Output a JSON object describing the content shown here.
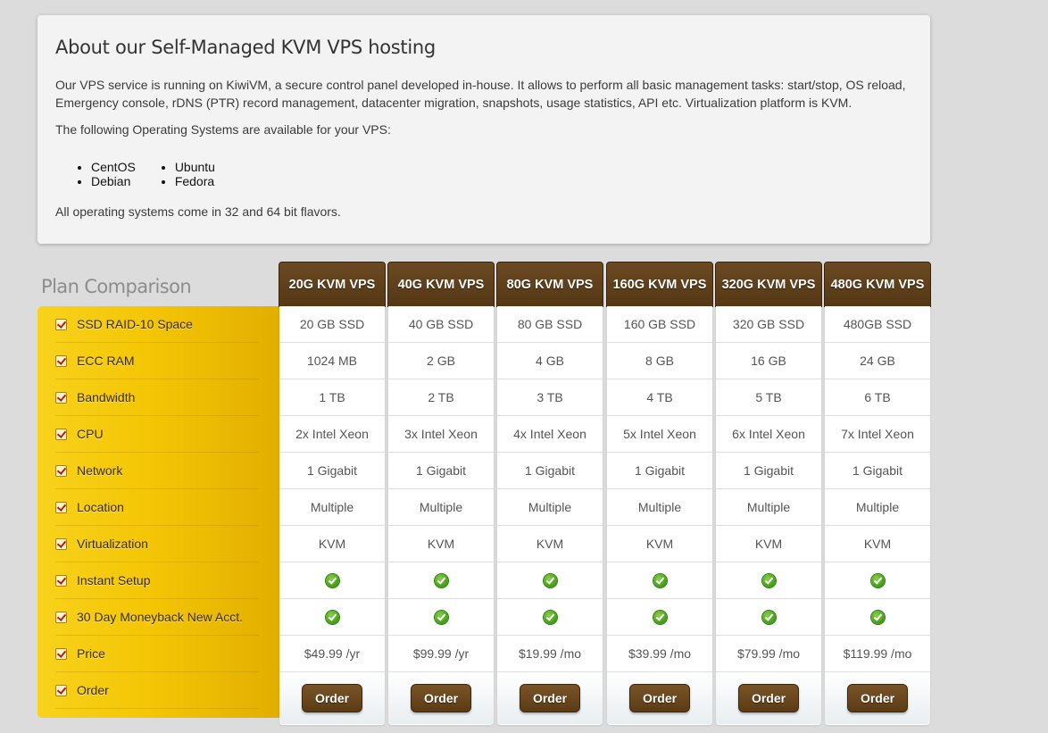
{
  "about": {
    "title": "About our Self-Managed KVM VPS hosting",
    "description": "Our VPS service is running on KiwiVM, a secure control panel developed in-house. It allows to perform all basic management tasks: start/stop, OS reload, Emergency console, rDNS (PTR) record management, datacenter migration, snapshots, usage statistics, API etc. Virtualization platform is KVM.",
    "os_intro": "The following Operating Systems are available for your VPS:",
    "os_columns": [
      [
        "CentOS",
        "Debian"
      ],
      [
        "Ubuntu",
        "Fedora"
      ]
    ],
    "footer": "All operating systems come in 32 and 64 bit flavors."
  },
  "plan_comparison": {
    "title": "Plan Comparison",
    "features": [
      "SSD RAID-10 Space",
      "ECC RAM",
      "Bandwidth",
      "CPU",
      "Network",
      "Location",
      "Virtualization",
      "Instant Setup",
      "30 Day Moneyback New Acct.",
      "Price",
      "Order"
    ],
    "order_label": "Order",
    "check_icon": "check-circle-icon",
    "plans": [
      {
        "name": "20G KVM VPS",
        "values": [
          "20 GB SSD",
          "1024 MB",
          "1 TB",
          "2x Intel Xeon",
          "1 Gigabit",
          "Multiple",
          "KVM"
        ],
        "instant_setup": true,
        "moneyback": true,
        "price": "$49.99 /yr"
      },
      {
        "name": "40G KVM VPS",
        "values": [
          "40 GB SSD",
          "2 GB",
          "2 TB",
          "3x Intel Xeon",
          "1 Gigabit",
          "Multiple",
          "KVM"
        ],
        "instant_setup": true,
        "moneyback": true,
        "price": "$99.99 /yr"
      },
      {
        "name": "80G KVM VPS",
        "values": [
          "80 GB SSD",
          "4 GB",
          "3 TB",
          "4x Intel Xeon",
          "1 Gigabit",
          "Multiple",
          "KVM"
        ],
        "instant_setup": true,
        "moneyback": true,
        "price": "$19.99 /mo"
      },
      {
        "name": "160G KVM VPS",
        "values": [
          "160 GB SSD",
          "8 GB",
          "4 TB",
          "5x Intel Xeon",
          "1 Gigabit",
          "Multiple",
          "KVM"
        ],
        "instant_setup": true,
        "moneyback": true,
        "price": "$39.99 /mo"
      },
      {
        "name": "320G KVM VPS",
        "values": [
          "320 GB SSD",
          "16 GB",
          "5 TB",
          "6x Intel Xeon",
          "1 Gigabit",
          "Multiple",
          "KVM"
        ],
        "instant_setup": true,
        "moneyback": true,
        "price": "$79.99 /mo"
      },
      {
        "name": "480G KVM VPS",
        "values": [
          "480GB SSD",
          "24 GB",
          "6 TB",
          "7x Intel Xeon",
          "1 Gigabit",
          "Multiple",
          "KVM"
        ],
        "instant_setup": true,
        "moneyback": true,
        "price": "$119.99 /mo"
      }
    ]
  },
  "colors": {
    "feature_column": "#f4c605",
    "plan_header": "#5e3f1a",
    "order_button": "#6b4a22",
    "check_green": "#3d9a13"
  }
}
